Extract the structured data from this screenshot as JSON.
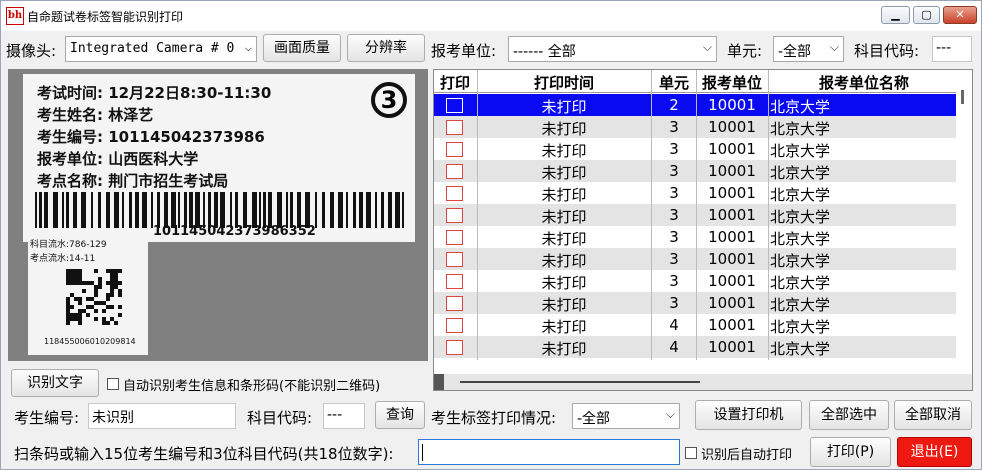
{
  "window": {
    "title": "自命题试卷标签智能识别打印",
    "icon_text": "bh",
    "minimize": "▁",
    "restore": "▢",
    "close": "✕"
  },
  "toolbar": {
    "camera_label": "摄像头:",
    "camera_value": "Integrated Camera # 0",
    "quality_button": "画面质量",
    "resolution_button": "分辨率",
    "unit_label": "报考单位:",
    "unit_value": "------ 全部",
    "section_label": "单元:",
    "section_value": "-全部",
    "subject_label": "科目代码:",
    "subject_value": "---"
  },
  "preview": {
    "lines": [
      "考试时间:  12月22日8:30-11:30",
      "考生姓名:  林泽艺",
      "考生编号:  101145042373986",
      "报考单位:  山西医科大学",
      "考点名称:  荆门市招生考试局"
    ],
    "circled_number": "3",
    "barcode_number": "101145042373986352",
    "small_lines": [
      "科目流水:786-129",
      "考点流水:14-11"
    ],
    "qr_number": "118455006010209814"
  },
  "table": {
    "columns": [
      "打印",
      "打印时间",
      "单元",
      "报考单位",
      "报考单位名称"
    ],
    "rows": [
      {
        "time": "未打印",
        "unit": "2",
        "code": "10001",
        "name": "北京大学"
      },
      {
        "time": "未打印",
        "unit": "3",
        "code": "10001",
        "name": "北京大学"
      },
      {
        "time": "未打印",
        "unit": "3",
        "code": "10001",
        "name": "北京大学"
      },
      {
        "time": "未打印",
        "unit": "3",
        "code": "10001",
        "name": "北京大学"
      },
      {
        "time": "未打印",
        "unit": "3",
        "code": "10001",
        "name": "北京大学"
      },
      {
        "time": "未打印",
        "unit": "3",
        "code": "10001",
        "name": "北京大学"
      },
      {
        "time": "未打印",
        "unit": "3",
        "code": "10001",
        "name": "北京大学"
      },
      {
        "time": "未打印",
        "unit": "3",
        "code": "10001",
        "name": "北京大学"
      },
      {
        "time": "未打印",
        "unit": "3",
        "code": "10001",
        "name": "北京大学"
      },
      {
        "time": "未打印",
        "unit": "3",
        "code": "10001",
        "name": "北京大学"
      },
      {
        "time": "未打印",
        "unit": "4",
        "code": "10001",
        "name": "北京大学"
      },
      {
        "time": "未打印",
        "unit": "4",
        "code": "10001",
        "name": "北京大学"
      }
    ]
  },
  "recognize": {
    "button": "识别文字",
    "auto_label": "自动识别考生信息和条形码(不能识别二维码)"
  },
  "query": {
    "student_label": "考生编号:",
    "student_value": "未识别",
    "subject_label": "科目代码:",
    "subject_value": "---",
    "query_button": "查询",
    "print_status_label": "考生标签打印情况:",
    "print_status_value": "-全部",
    "printer_button": "设置打印机",
    "select_all_button": "全部选中",
    "deselect_all_button": "全部取消"
  },
  "scan": {
    "label": "扫条码或输入15位考生编号和3位科目代码(共18位数字):",
    "input_value": "",
    "auto_print_label": "识别后自动打印",
    "print_button": "打印(P)",
    "exit_button": "退出(E)"
  }
}
